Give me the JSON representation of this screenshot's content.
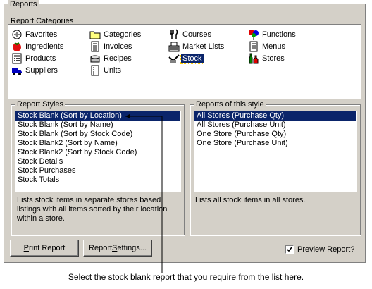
{
  "reports": {
    "title": "Reports",
    "categories_label": "Report Categories",
    "categories": [
      {
        "label": "Favorites",
        "icon": "favorites-icon"
      },
      {
        "label": "Categories",
        "icon": "folder-icon"
      },
      {
        "label": "Courses",
        "icon": "cutlery-icon"
      },
      {
        "label": "Functions",
        "icon": "balloons-icon"
      },
      {
        "label": "Ingredients",
        "icon": "tomato-icon"
      },
      {
        "label": "Invoices",
        "icon": "invoice-icon"
      },
      {
        "label": "Market Lists",
        "icon": "cash-register-icon"
      },
      {
        "label": "Menus",
        "icon": "menu-icon"
      },
      {
        "label": "Products",
        "icon": "calculator-icon"
      },
      {
        "label": "Recipes",
        "icon": "pot-icon"
      },
      {
        "label": "Stock",
        "icon": "stock-icon",
        "selected": true
      },
      {
        "label": "Stores",
        "icon": "bottles-icon"
      },
      {
        "label": "Suppliers",
        "icon": "truck-icon"
      },
      {
        "label": "Units",
        "icon": "units-icon"
      }
    ],
    "styles": {
      "label": "Report Styles",
      "items": [
        {
          "label": "Stock Blank (Sort by Location)",
          "selected": true
        },
        {
          "label": "Stock Blank (Sort by Name)"
        },
        {
          "label": "Stock Blank (Sort by Stock Code)"
        },
        {
          "label": "Stock Blank2 (Sort by Name)"
        },
        {
          "label": "Stock Blank2 (Sort by Stock Code)"
        },
        {
          "label": "Stock Details"
        },
        {
          "label": "Stock Purchases"
        },
        {
          "label": "Stock Totals"
        }
      ],
      "description": "Lists stock items in separate stores based listings with all items sorted by their location within a store."
    },
    "of_style": {
      "label": "Reports of this style",
      "items": [
        {
          "label": "All Stores (Purchase Qty)",
          "selected": true
        },
        {
          "label": "All Stores (Purchase Unit)"
        },
        {
          "label": "One Store (Purchase Qty)"
        },
        {
          "label": "One Store (Purchase Unit)"
        }
      ],
      "description": "Lists all stock items in all stores."
    },
    "print_button": {
      "hotkey": "P",
      "rest": "rint Report"
    },
    "settings_button": {
      "pre": "Report ",
      "hotkey": "S",
      "rest": "ettings..."
    },
    "preview": {
      "label": "Preview Report?",
      "checked": true
    },
    "accent": "#0a246a"
  },
  "callout": "Select the stock blank report that you require from the list here."
}
